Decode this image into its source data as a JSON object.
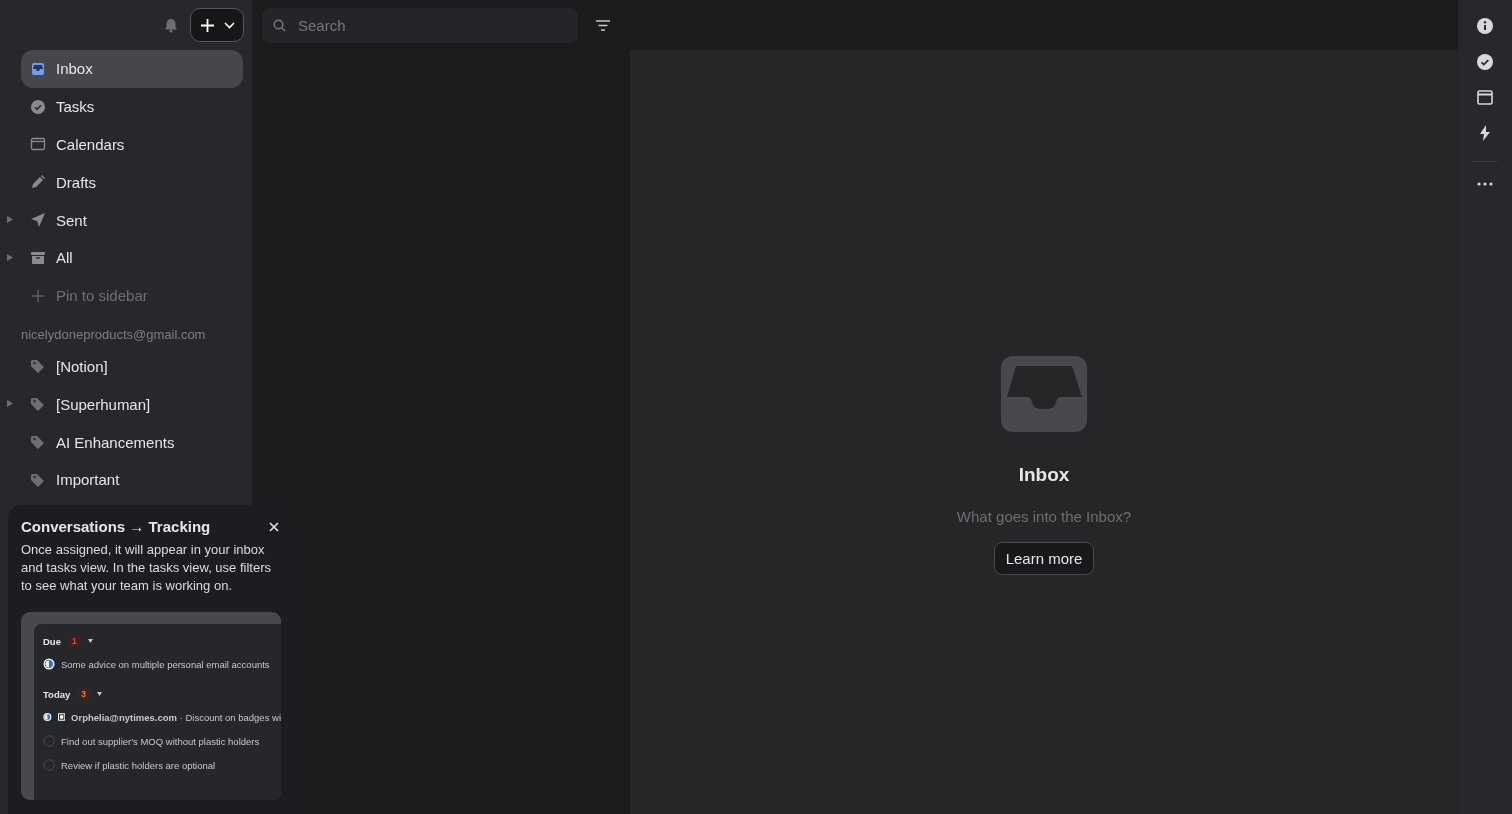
{
  "toolbar": {
    "search": {
      "placeholder": "Search"
    }
  },
  "sidebar": {
    "items": [
      {
        "label": "Inbox",
        "selected": true
      },
      {
        "label": "Tasks",
        "selected": false
      },
      {
        "label": "Calendars",
        "selected": false
      },
      {
        "label": "Drafts",
        "selected": false
      },
      {
        "label": "Sent",
        "selected": false,
        "expanded": false
      },
      {
        "label": "All",
        "selected": false,
        "expanded": false
      }
    ],
    "pin_action": "Pin to sidebar",
    "account": {
      "email": "nicelydoneproducts@gmail.com",
      "labels": [
        {
          "label": "[Notion]",
          "selected": false
        },
        {
          "label": "[Superhuman]",
          "selected": false,
          "expanded": false
        },
        {
          "label": "AI Enhancements",
          "selected": false
        },
        {
          "label": "Important",
          "selected": false
        }
      ]
    }
  },
  "empty_state": {
    "title": "Inbox",
    "subtitle": "What goes into the Inbox?",
    "button": "Learn more"
  },
  "popup": {
    "title": "Conversations → Tracking",
    "body": "Once assigned, it will appear in your inbox and tasks view. In the tasks view, use filters to see what your team is working on.",
    "preview": {
      "groups": [
        {
          "title": "Due",
          "count": "1",
          "color": "#e0483e",
          "tasks": [
            {
              "kind": "assigned",
              "text": "Some advice on multiple personal email accounts"
            }
          ]
        },
        {
          "title": "Today",
          "count": "3",
          "color": "#e0852e",
          "tasks": [
            {
              "kind": "email",
              "text": "**Orphelia@nytimes.com** · Discount on badges wi"
            },
            {
              "kind": "open",
              "text": "Find out supplier's MOQ without plastic holders"
            },
            {
              "kind": "open",
              "text": "Review if plastic holders are optional"
            }
          ]
        }
      ]
    }
  }
}
